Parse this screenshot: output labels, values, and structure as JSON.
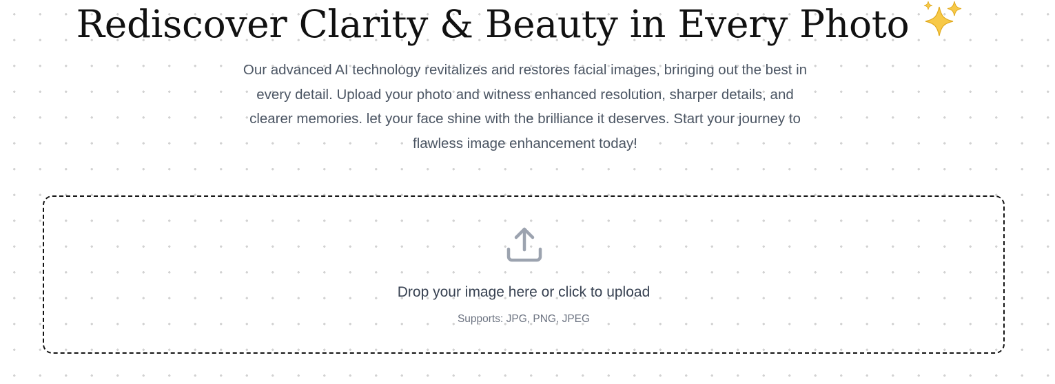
{
  "hero": {
    "title": "Rediscover Clarity & Beauty in Every Photo",
    "title_icon": "sparkles-icon",
    "description": "Our advanced AI technology revitalizes and restores facial images, bringing out the best in every detail. Upload your photo and witness enhanced resolution, sharper details, and clearer memories. let your face shine with the brilliance it deserves. Start your journey to flawless image enhancement today!"
  },
  "upload": {
    "icon": "upload-icon",
    "title": "Drop your image here or click to upload",
    "subtitle": "Supports: JPG, PNG, JPEG"
  },
  "colors": {
    "title_text": "#111111",
    "body_text": "#4b5563",
    "muted_text": "#6b7280",
    "icon_gray": "#9ca3af",
    "sparkle_yellow": "#f7c948",
    "dot_grid": "#d2d2d2",
    "dropzone_border": "#111111"
  }
}
